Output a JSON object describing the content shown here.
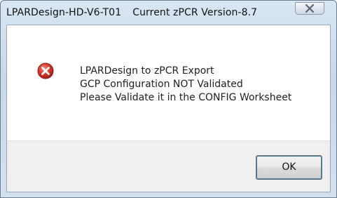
{
  "window": {
    "title_left": "LPARDesign-HD-V6-T01",
    "title_right": "Current zPCR Version-8.7"
  },
  "dialog": {
    "icon": "error-icon",
    "message_lines": [
      "LPARDesign to zPCR Export",
      "GCP Configuration NOT Validated",
      "Please Validate it in the CONFIG Worksheet"
    ],
    "ok_label": "OK"
  },
  "colors": {
    "error_red": "#c9302c",
    "title_bar": "#c7d8ea",
    "footer_bg": "#f0f0f0",
    "focus_ring": "#3c7fb1"
  }
}
